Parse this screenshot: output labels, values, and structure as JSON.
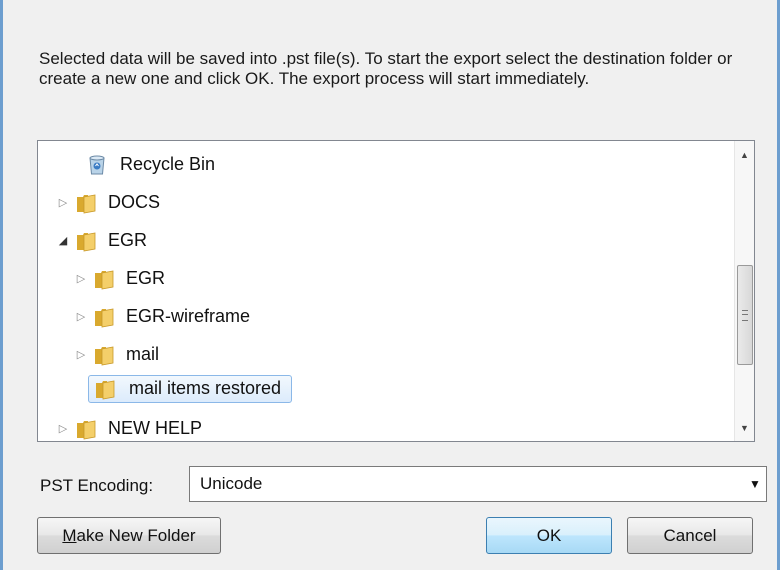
{
  "description": "Selected data will be saved into .pst file(s). To start the export select the destination folder or create a new one and click OK. The export process will start immediately.",
  "tree": {
    "items": [
      {
        "label": "Recycle Bin",
        "icon": "recycle-bin-icon",
        "expander": ""
      },
      {
        "label": "DOCS",
        "icon": "folder-icon",
        "expander": "collapsed"
      },
      {
        "label": "EGR",
        "icon": "folder-icon",
        "expander": "expanded"
      },
      {
        "label": "EGR",
        "icon": "folder-icon",
        "expander": "collapsed"
      },
      {
        "label": "EGR-wireframe",
        "icon": "folder-icon",
        "expander": "collapsed"
      },
      {
        "label": "mail",
        "icon": "folder-icon",
        "expander": "collapsed"
      },
      {
        "label": "mail items restored",
        "icon": "folder-icon",
        "expander": "",
        "selected": true
      },
      {
        "label": "NEW HELP",
        "icon": "folder-icon",
        "expander": "collapsed"
      }
    ],
    "scroll_position": 0.5
  },
  "encoding": {
    "label": "PST Encoding:",
    "value": "Unicode"
  },
  "buttons": {
    "make_new_folder_prefix": "M",
    "make_new_folder_rest": "ake New Folder",
    "ok": "OK",
    "cancel": "Cancel"
  },
  "colors": {
    "window_border": "#6d9ecf",
    "selection_border": "#8bb8e8",
    "default_button_border": "#3c7fb1"
  }
}
